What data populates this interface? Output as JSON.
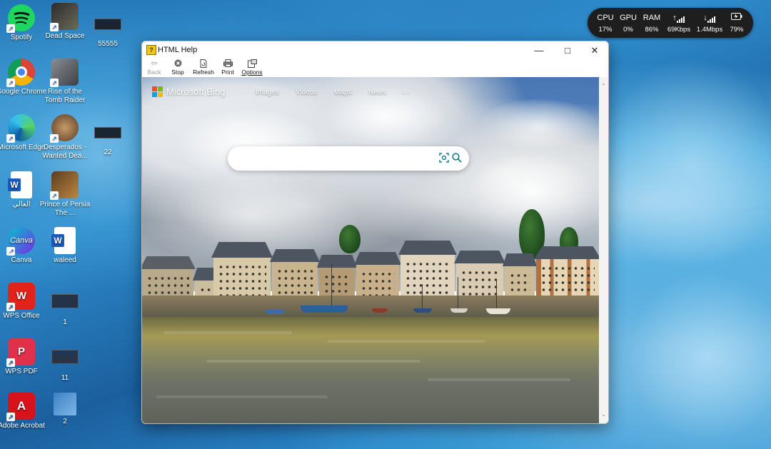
{
  "desktop": {
    "icons": [
      {
        "label": "Spotify",
        "icon": "spotify-icon"
      },
      {
        "label": "Dead Space",
        "icon": "dead-space-icon"
      },
      {
        "label": "55555",
        "icon": "thumbnail-icon"
      },
      {
        "label": "Google Chrome",
        "icon": "chrome-icon"
      },
      {
        "label": "Rise of the Tomb Raider",
        "icon": "tomb-raider-icon"
      },
      {
        "label": "Microsoft Edge",
        "icon": "edge-icon"
      },
      {
        "label": "Desperados - Wanted Dea...",
        "icon": "desperados-icon"
      },
      {
        "label": "22",
        "icon": "thumbnail-icon"
      },
      {
        "label": "العالي",
        "icon": "word-doc-icon"
      },
      {
        "label": "Prince of Persia The ...",
        "icon": "prince-of-persia-icon"
      },
      {
        "label": "Canva",
        "icon": "canva-icon"
      },
      {
        "label": "waleed",
        "icon": "word-doc-icon"
      },
      {
        "label": "WPS Office",
        "icon": "wps-office-icon"
      },
      {
        "label": "1",
        "icon": "thumbnail-icon"
      },
      {
        "label": "WPS PDF",
        "icon": "wps-pdf-icon"
      },
      {
        "label": "11",
        "icon": "thumbnail-icon"
      },
      {
        "label": "Adobe Acrobat",
        "icon": "acrobat-icon"
      },
      {
        "label": "2",
        "icon": "thumbnail-icon"
      }
    ]
  },
  "perf_widget": {
    "cpu_label": "CPU",
    "cpu_value": "17%",
    "gpu_label": "GPU",
    "gpu_value": "0%",
    "ram_label": "RAM",
    "ram_value": "86%",
    "up_value": "69Kbps",
    "down_value": "1.4Mbps",
    "battery_value": "79%"
  },
  "window": {
    "title": "HTML Help",
    "toolbar": {
      "back": "Back",
      "stop": "Stop",
      "refresh": "Refresh",
      "print": "Print",
      "options": "Options"
    }
  },
  "bing": {
    "brand": "Microsoft Bing",
    "nav": [
      "Images",
      "Videos",
      "Maps",
      "News",
      "···"
    ],
    "search_placeholder": ""
  },
  "colors": {
    "bing_ms_red": "#f25022",
    "bing_ms_green": "#7fba00",
    "bing_ms_blue": "#00a4ef",
    "bing_ms_yellow": "#ffb900",
    "search_icon": "#0f7c90"
  }
}
